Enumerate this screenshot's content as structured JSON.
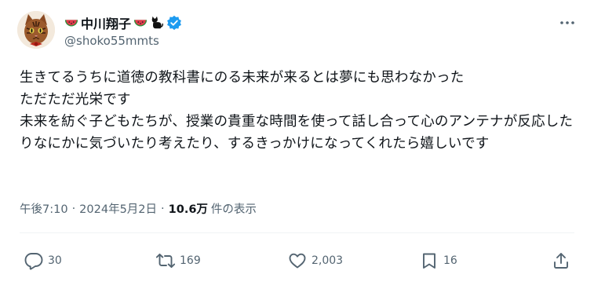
{
  "author": {
    "display_name": "中川翔子",
    "handle": "@shoko55mmts",
    "verified": true,
    "name_emojis": [
      "watermelon",
      "watermelon",
      "black-cat"
    ]
  },
  "tweet": {
    "text": "生きてるうちに道徳の教科書にのる未来が来るとは夢にも思わなかった\nただただ光栄です\n未来を紡ぐ子どもたちが、授業の貴重な時間を使って話し合って心のアンテナが反応したりなにかに気づいたり考えたり、するきっかけになってくれたら嬉しいです",
    "time": "午後7:10",
    "date": "2024年5月2日",
    "separator": "·",
    "views": "10.6万",
    "views_label": "件の表示"
  },
  "actions": {
    "reply_count": "30",
    "repost_count": "169",
    "like_count": "2,003",
    "bookmark_count": "16"
  },
  "colors": {
    "text": "#0f1419",
    "secondary": "#536471",
    "verified": "#1d9bf0",
    "divider": "#eff3f4"
  }
}
